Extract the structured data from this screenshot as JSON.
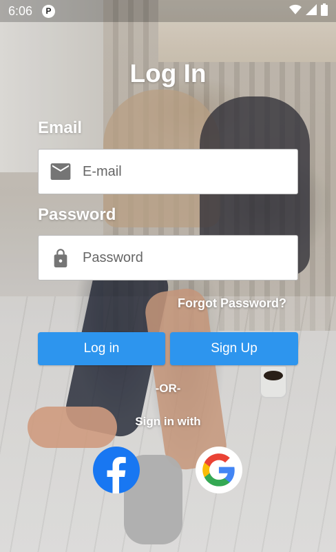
{
  "status_bar": {
    "time": "6:06",
    "notification_icon": "nfc-app-icon",
    "right_icons": [
      "wifi-icon",
      "signal-icon",
      "battery-icon"
    ]
  },
  "screen": {
    "title": "Log In",
    "email": {
      "label": "Email",
      "placeholder": "E-mail",
      "value": "",
      "icon": "mail-icon"
    },
    "password": {
      "label": "Password",
      "placeholder": "Password",
      "value": "",
      "icon": "lock-icon"
    },
    "forgot_password": "Forgot Password?",
    "login_button": "Log in",
    "signup_button": "Sign Up",
    "or_divider": "-OR-",
    "sign_in_with": "Sign in with",
    "social_providers": [
      "facebook-icon",
      "google-icon"
    ]
  },
  "colors": {
    "primary": "#2d95ee",
    "facebook": "#1877f2",
    "google_blue": "#4285f4",
    "google_red": "#ea4335",
    "google_yellow": "#fbbc05",
    "google_green": "#34a853"
  }
}
